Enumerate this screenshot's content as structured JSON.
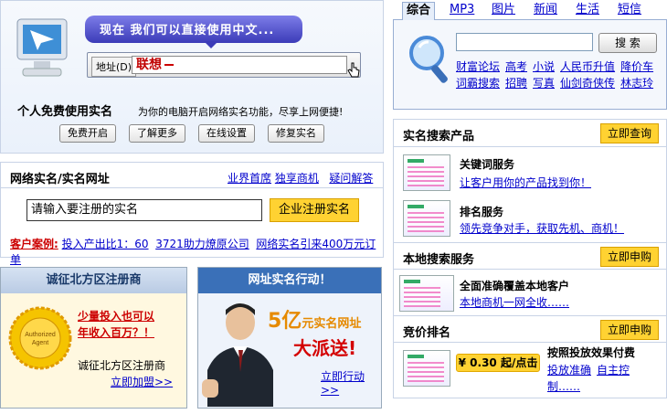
{
  "promo": {
    "bubble_text": "现在 我们可以直接使用中文...",
    "address_label": "地址(D)",
    "address_value": "联想",
    "title": "个人免费使用实名",
    "desc": "为你的电脑开启网络实名功能，尽享上网便捷!",
    "buttons": [
      "免费开启",
      "了解更多",
      "在线设置",
      "修复实名"
    ]
  },
  "search": {
    "tabs": [
      "综合",
      "MP3",
      "图片",
      "新闻",
      "生活",
      "短信"
    ],
    "button": "搜 索",
    "links_row1": [
      "财富论坛",
      "高考",
      "小说",
      "人民币升值",
      "降价车"
    ],
    "links_row2": [
      "词霸搜索",
      "招聘",
      "写真",
      "仙剑奇侠传",
      "林志玲"
    ]
  },
  "realname": {
    "title": "网络实名/实名网址",
    "links": [
      "业界首席",
      "独享商机",
      "疑问解答"
    ],
    "input_value": "请输入要注册的实名",
    "register_button": "企业注册实名",
    "cases_label": "客户案例:",
    "cases": [
      "投入产出比1：60",
      "3721助力燎原公司",
      "网络实名引来400万元订单"
    ]
  },
  "card_left": {
    "title": "诚征北方区注册商",
    "slogan_line1": "少量投入也可以",
    "slogan_line2": "年收入百万？！",
    "seal_text": "Authorized Agent",
    "line": "诚征北方区注册商",
    "link": "立即加盟>>"
  },
  "card_right": {
    "title": "网址实名行动！",
    "big1": "5亿",
    "big1b": "元实名网址",
    "big2": "大派送!",
    "link": "立即行动>>"
  },
  "products": {
    "sec1_title": "实名搜索产品",
    "sec1_button": "立即查询",
    "item1_title": "关键词服务",
    "item1_link": "让客户用你的产品找到你！",
    "item2_title": "排名服务",
    "item2_link": "领先竞争对手，获取先机、商机！",
    "sec2_title": "本地搜索服务",
    "sec2_button": "立即申购",
    "item3_title": "全面准确覆盖本地客户",
    "item3_link": "本地商机一网全收……",
    "sec3_title": "竞价排名",
    "sec3_button": "立即申购",
    "price": "¥ 0.30 起/点击",
    "item4_title": "按照投放效果付费",
    "item4_link1": "投放准确",
    "item4_link2": "自主控",
    "item4_link3": "制……"
  },
  "colors": {
    "accent_yellow": "#ffd232",
    "link_blue": "#0000cc",
    "case_red": "#cc0000"
  }
}
